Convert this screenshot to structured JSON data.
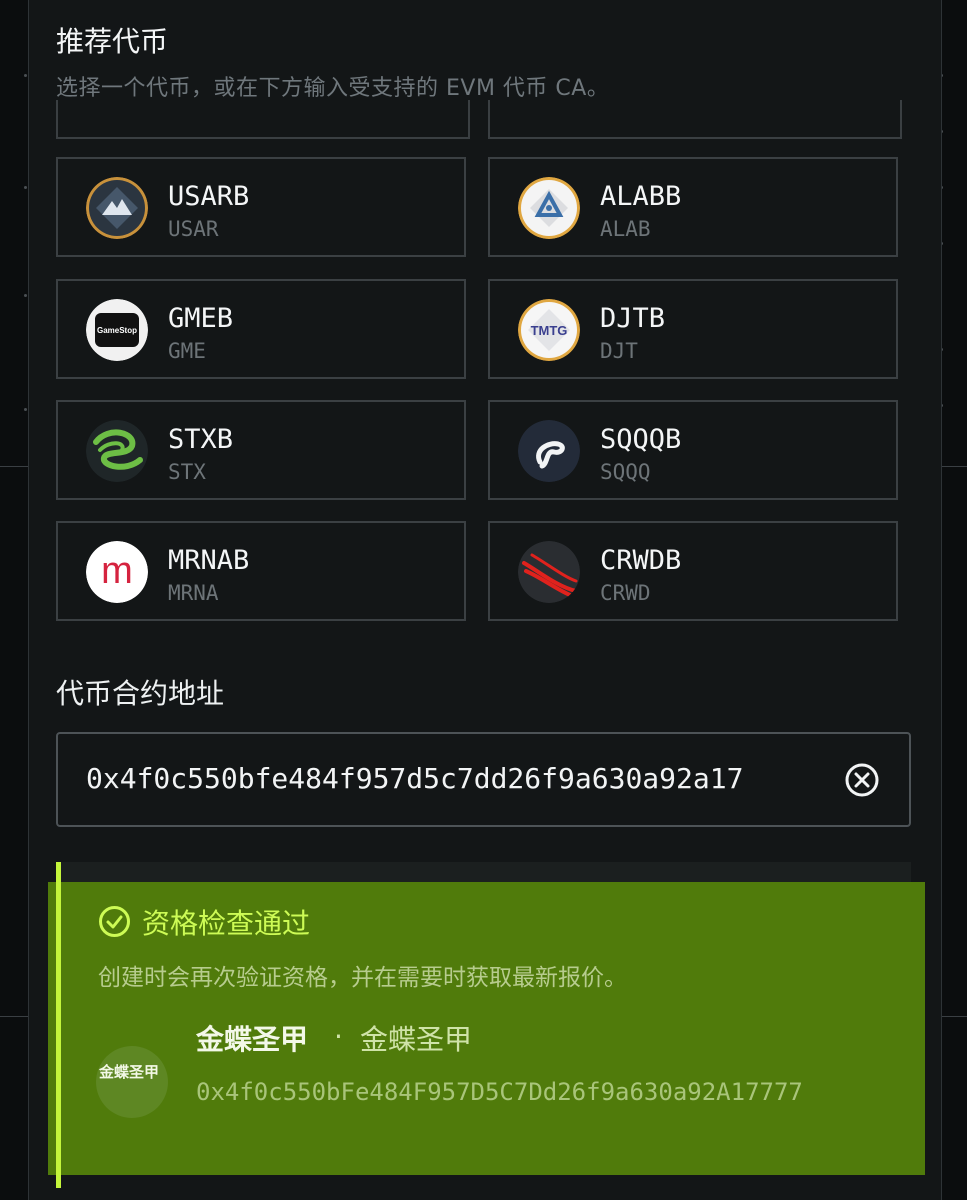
{
  "header": {
    "title": "推荐代币",
    "subtitle": "选择一个代币，或在下方输入受支持的 EVM 代币 CA。"
  },
  "tokens": [
    {
      "name": "USARB",
      "symbol": "USAR",
      "icon": "usar-mountain-icon"
    },
    {
      "name": "ALABB",
      "symbol": "ALAB",
      "icon": "alab-triangle-icon"
    },
    {
      "name": "GMEB",
      "symbol": "GME",
      "icon": "gamestop-icon",
      "logo_text": "GameStop"
    },
    {
      "name": "DJTB",
      "symbol": "DJT",
      "icon": "tmtg-icon",
      "logo_text": "TMTG"
    },
    {
      "name": "STXB",
      "symbol": "STX",
      "icon": "seagate-icon"
    },
    {
      "name": "SQQQB",
      "symbol": "SQQQ",
      "icon": "sqqq-swirl-icon"
    },
    {
      "name": "MRNAB",
      "symbol": "MRNA",
      "icon": "moderna-icon",
      "logo_text": "m"
    },
    {
      "name": "CRWDB",
      "symbol": "CRWD",
      "icon": "crowdstrike-icon"
    }
  ],
  "contract": {
    "label": "代币合约地址",
    "value": "0x4f0c550bfe484f957d5c7dd26f9a630a92a17"
  },
  "result": {
    "title": "资格检查通过",
    "description": "创建时会再次验证资格，并在需要时获取最新报价。",
    "avatar_text": "金蝶圣甲",
    "name": "金蝶圣甲",
    "separator": "·",
    "symbol": "金蝶圣甲",
    "address": "0x4f0c550bFe484F957D5C7Dd26f9a630a92A17777"
  },
  "colors": {
    "success_bg": "#507b0b",
    "success_accent": "#c4f53b",
    "panel_bg": "#131617",
    "card_border": "#3b4043"
  }
}
